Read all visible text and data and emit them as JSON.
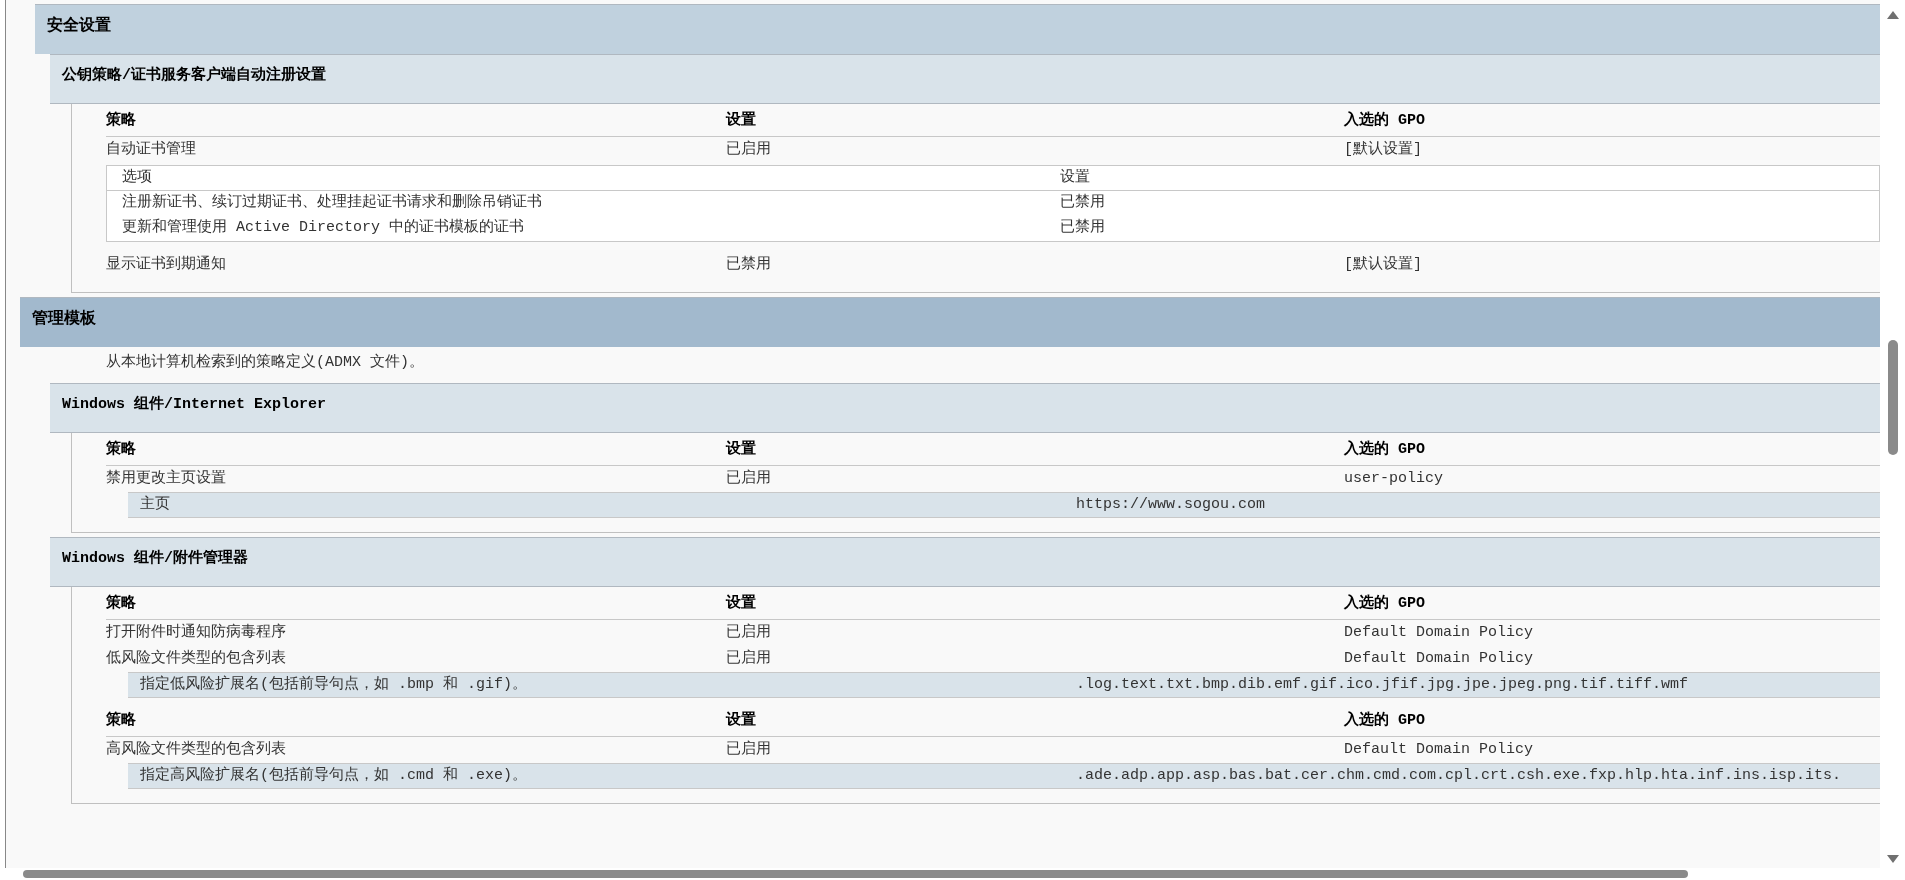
{
  "sections": [
    {
      "title": "安全设置",
      "kind": "nested",
      "subsections": [
        {
          "title": "公钥策略/证书服务客户端自动注册设置",
          "tables": [
            {
              "columns": [
                "策略",
                "设置",
                "入选的 GPO"
              ],
              "rows": [
                {
                  "policy": "自动证书管理",
                  "setting": "已启用",
                  "gpo": "[默认设置]",
                  "detail": {
                    "kind": "option_table",
                    "columns": [
                      "选项",
                      "设置"
                    ],
                    "rows": [
                      [
                        "注册新证书、续订过期证书、处理挂起证书请求和删除吊销证书",
                        "已禁用"
                      ],
                      [
                        "更新和管理使用 Active Directory 中的证书模板的证书",
                        "已禁用"
                      ]
                    ]
                  }
                },
                {
                  "policy": "显示证书到期通知",
                  "setting": "已禁用",
                  "gpo": "[默认设置]"
                }
              ]
            }
          ]
        }
      ]
    },
    {
      "title": "管理模板",
      "kind": "top",
      "description": "从本地计算机检索到的策略定义(ADMX 文件)。",
      "subsections": [
        {
          "title": "Windows 组件/Internet Explorer",
          "tables": [
            {
              "columns": [
                "策略",
                "设置",
                "入选的 GPO"
              ],
              "rows": [
                {
                  "policy": "禁用更改主页设置",
                  "setting": "已启用",
                  "gpo": "user-policy",
                  "detail": {
                    "kind": "value_row",
                    "label": "主页",
                    "value": "https://www.sogou.com"
                  }
                }
              ]
            }
          ]
        },
        {
          "title": "Windows 组件/附件管理器",
          "tables": [
            {
              "columns": [
                "策略",
                "设置",
                "入选的 GPO"
              ],
              "rows": [
                {
                  "policy": "打开附件时通知防病毒程序",
                  "setting": "已启用",
                  "gpo": "Default Domain Policy"
                },
                {
                  "policy": "低风险文件类型的包含列表",
                  "setting": "已启用",
                  "gpo": "Default Domain Policy",
                  "detail": {
                    "kind": "value_row",
                    "label": "指定低风险扩展名(包括前导句点，如 .bmp 和 .gif)。",
                    "value": ".log.text.txt.bmp.dib.emf.gif.ico.jfif.jpg.jpe.jpeg.png.tif.tiff.wmf"
                  }
                }
              ]
            },
            {
              "columns": [
                "策略",
                "设置",
                "入选的 GPO"
              ],
              "rows": [
                {
                  "policy": "高风险文件类型的包含列表",
                  "setting": "已启用",
                  "gpo": "Default Domain Policy",
                  "detail": {
                    "kind": "value_row",
                    "label": "指定高风险扩展名(包括前导句点，如 .cmd 和 .exe)。",
                    "value": ".ade.adp.app.asp.bas.bat.cer.chm.cmd.com.cpl.crt.csh.exe.fxp.hlp.hta.inf.ins.isp.its."
                  }
                }
              ]
            }
          ]
        }
      ]
    }
  ]
}
